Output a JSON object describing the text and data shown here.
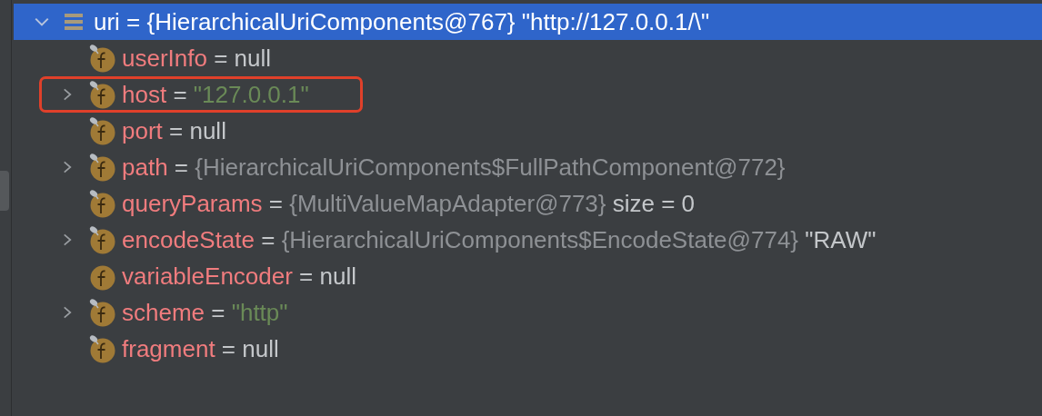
{
  "root": {
    "name": "uri",
    "op": "=",
    "value": "{HierarchicalUriComponents@767}",
    "extra": "\"http://127.0.0.1/\\\"",
    "expanded": true,
    "selected": true
  },
  "fields": [
    {
      "name": "userInfo",
      "op": "=",
      "value": "null",
      "kind": "null",
      "expandable": false,
      "marker": true,
      "highlighted": false
    },
    {
      "name": "host",
      "op": "=",
      "value": "\"127.0.0.1\"",
      "kind": "string",
      "expandable": true,
      "marker": true,
      "highlighted": true
    },
    {
      "name": "port",
      "op": "=",
      "value": "null",
      "kind": "null",
      "expandable": false,
      "marker": true,
      "highlighted": false
    },
    {
      "name": "path",
      "op": "=",
      "value": "{HierarchicalUriComponents$FullPathComponent@772}",
      "kind": "object",
      "expandable": true,
      "marker": true,
      "highlighted": false
    },
    {
      "name": "queryParams",
      "op": "=",
      "value": "{MultiValueMapAdapter@773}",
      "kind": "object",
      "extra": "size = 0",
      "expandable": false,
      "marker": true,
      "highlighted": false
    },
    {
      "name": "encodeState",
      "op": "=",
      "value": "{HierarchicalUriComponents$EncodeState@774}",
      "kind": "object",
      "extra": "\"RAW\"",
      "expandable": true,
      "marker": true,
      "highlighted": false
    },
    {
      "name": "variableEncoder",
      "op": "=",
      "value": "null",
      "kind": "null",
      "expandable": false,
      "marker": false,
      "highlighted": false
    },
    {
      "name": "scheme",
      "op": "=",
      "value": "\"http\"",
      "kind": "string",
      "expandable": true,
      "marker": true,
      "highlighted": false
    },
    {
      "name": "fragment",
      "op": "=",
      "value": "null",
      "kind": "null",
      "expandable": false,
      "marker": true,
      "highlighted": false
    }
  ]
}
